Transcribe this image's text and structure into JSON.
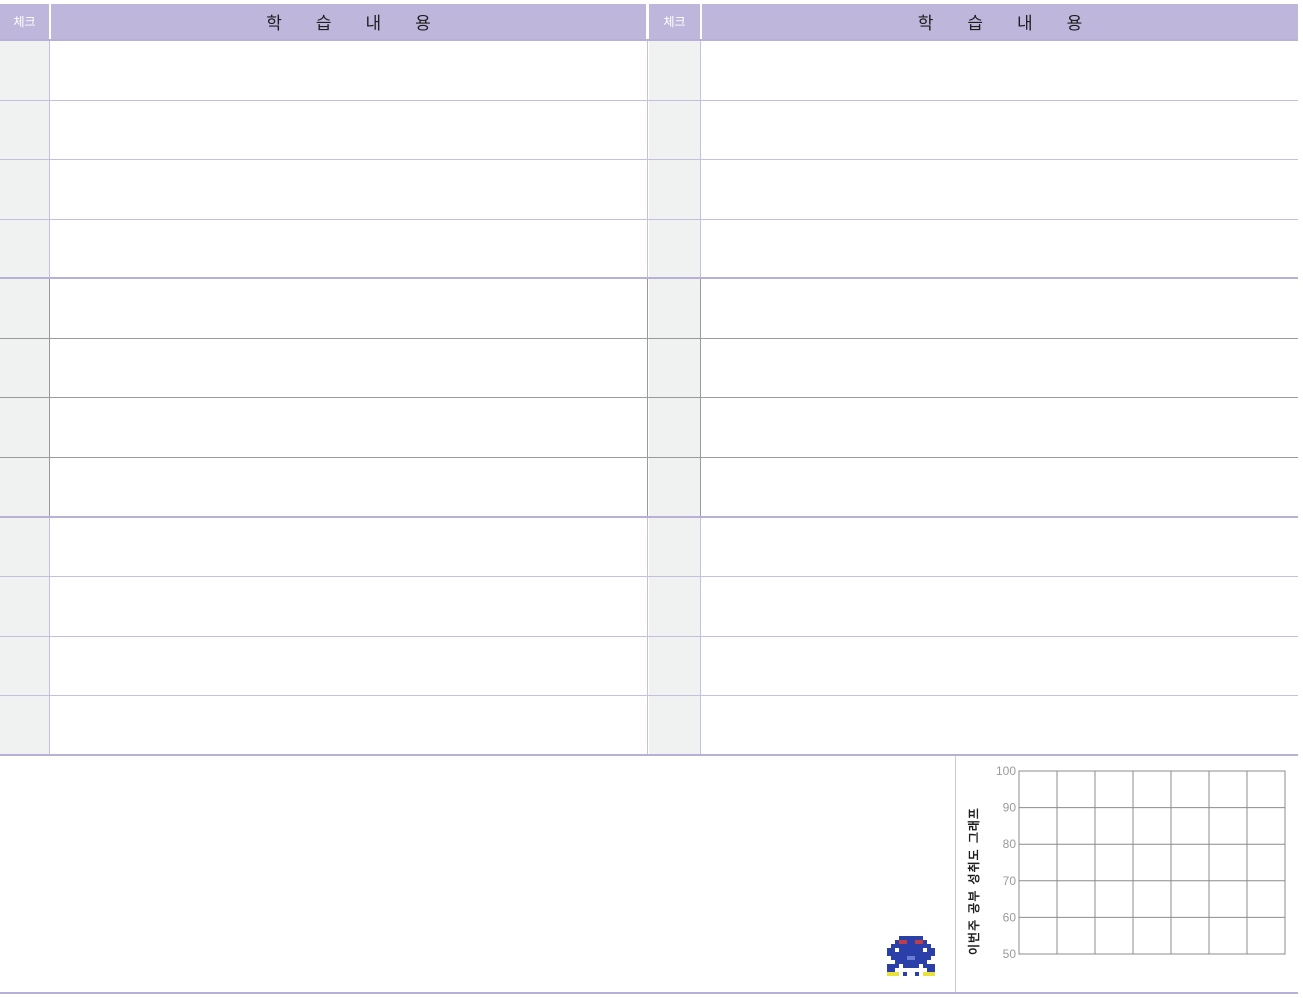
{
  "headers": {
    "check_label": "체크",
    "title_chars": [
      "학",
      "습",
      "내",
      "용"
    ]
  },
  "rows_per_column": 12,
  "chart_data": {
    "type": "line",
    "title": "이번주 공부 성취도 그래프",
    "ylim": [
      50,
      100
    ],
    "y_ticks": [
      "100",
      "90",
      "80",
      "70",
      "60",
      "50"
    ],
    "x_columns": 7,
    "grid": true,
    "series": []
  },
  "colors": {
    "header_bg": "#bfb6dc",
    "check_col_bg": "#f0f1f1",
    "row_line": "#c7bfe3",
    "mid_section_line": "#9a9a9a"
  },
  "icons": {
    "mascot": "pixel-robot-icon"
  }
}
